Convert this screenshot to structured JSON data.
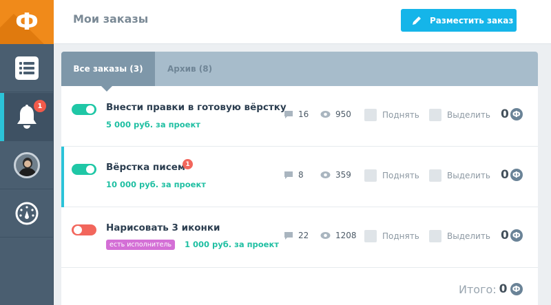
{
  "logo": {
    "letter": "Ф",
    "color": "#f08a1a"
  },
  "sidebar": {
    "items": [
      {
        "icon": "list-icon"
      },
      {
        "icon": "bell-icon",
        "badge": "1",
        "active": true
      },
      {
        "icon": "avatar"
      },
      {
        "icon": "dashboard-gauge-icon"
      }
    ]
  },
  "header": {
    "title": "Мои заказы",
    "place_button": "Разместить заказ",
    "place_button_icon": "pencil-icon",
    "accent": "#15b5e9"
  },
  "tabs": [
    {
      "label": "Все заказы (3)",
      "active": true
    },
    {
      "label": "Архив (8)",
      "active": false
    }
  ],
  "orders": [
    {
      "title": "Внести правки в готовую вёрстку",
      "price": "5 000 руб. за проект",
      "toggle": "on",
      "comments": "16",
      "views": "950",
      "raise_label": "Поднять",
      "highlight_label": "Выделить",
      "coins": "0"
    },
    {
      "title": "Вёрстка писем",
      "badge": "1",
      "price": "10 000 руб. за проект",
      "toggle": "on",
      "comments": "8",
      "views": "359",
      "raise_label": "Поднять",
      "highlight_label": "Выделить",
      "coins": "0"
    },
    {
      "title": "Нарисовать 3 иконки",
      "executor_tag": "есть исполнитель",
      "price": "1 000 руб. за проект",
      "toggle": "off",
      "comments": "22",
      "views": "1208",
      "raise_label": "Поднять",
      "highlight_label": "Выделить",
      "coins": "0"
    }
  ],
  "total": {
    "label": "Итого:",
    "value": "0"
  },
  "coin_symbol": "Ф"
}
